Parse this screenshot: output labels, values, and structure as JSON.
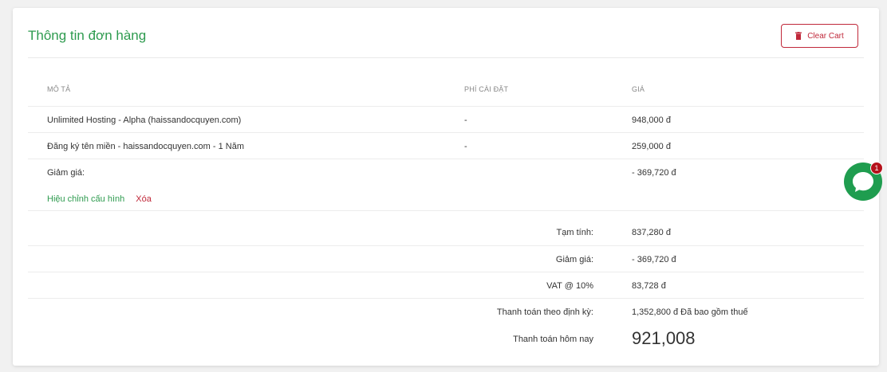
{
  "card": {
    "title": "Thông tin đơn hàng",
    "clear_cart_label": "Clear Cart"
  },
  "table": {
    "headers": {
      "description": "MÔ TẢ",
      "setup_fee": "PHÍ CÀI ĐẶT",
      "price": "GIÁ"
    },
    "items": [
      {
        "description": "Unlimited Hosting - Alpha (haissandocquyen.com)",
        "setup_fee": "-",
        "price": "948,000 đ"
      },
      {
        "description": "Đăng ký tên miền - haissandocquyen.com - 1 Năm",
        "setup_fee": "-",
        "price": "259,000 đ"
      }
    ],
    "discount_row": {
      "label": "Giảm giá:",
      "value": "- 369,720 đ"
    },
    "links": {
      "edit": "Hiệu chỉnh cấu hình",
      "delete": "Xóa"
    }
  },
  "summary": {
    "subtotal_label": "Tạm tính:",
    "subtotal_value": "837,280 đ",
    "discount_label": "Giảm giá:",
    "discount_value": "- 369,720 đ",
    "vat_label": "VAT @ 10%",
    "vat_value": "83,728 đ",
    "recurring_label": "Thanh toán theo định kỳ:",
    "recurring_value": "1,352,800 đ Đã bao gồm thuế",
    "today_label": "Thanh toán hôm nay",
    "today_value": "921,008"
  },
  "chat": {
    "badge_count": "1"
  },
  "colors": {
    "accent_green": "#2e9b4f",
    "danger_red": "#c0283a",
    "chat_green": "#1f9d4f"
  }
}
